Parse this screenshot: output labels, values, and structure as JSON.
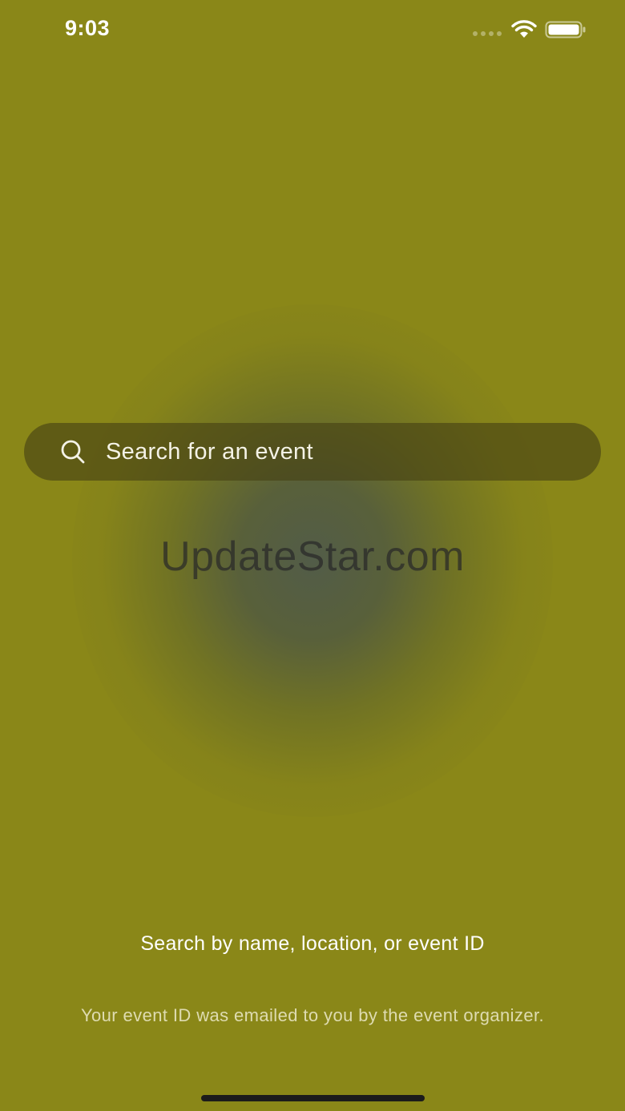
{
  "status_bar": {
    "time": "9:03",
    "wifi_icon": "wifi-icon",
    "battery_icon": "battery-icon"
  },
  "search": {
    "placeholder": "Search for an event",
    "icon": "search-icon"
  },
  "watermark": {
    "text": "UpdateStar.com"
  },
  "hint": {
    "title": "Search by name, location, or event ID",
    "subtitle": "Your event ID was emailed to you by the event organizer."
  },
  "colors": {
    "background": "#8a8718",
    "search_bar": "#4a4516",
    "text_primary": "#ffffff"
  }
}
